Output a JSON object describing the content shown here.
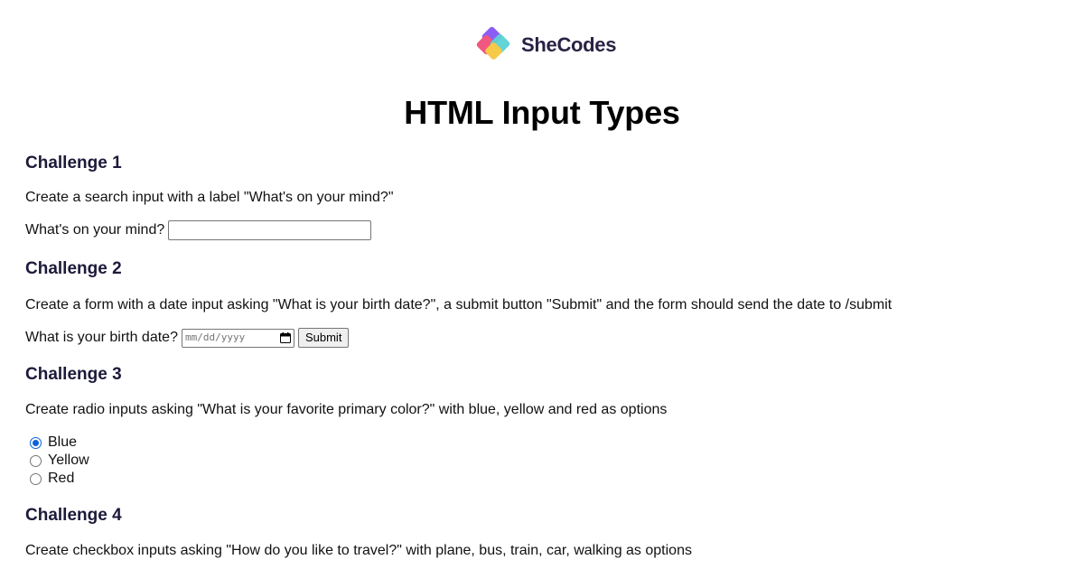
{
  "brand": {
    "name": "SheCodes"
  },
  "page": {
    "title": "HTML Input Types"
  },
  "challenges": [
    {
      "heading": "Challenge 1",
      "description": "Create a search input with a label \"What's on your mind?\"",
      "label": "What's on your mind?",
      "input_value": ""
    },
    {
      "heading": "Challenge 2",
      "description": "Create a form with a date input asking \"What is your birth date?\", a submit button \"Submit\" and the form should send the date to /submit",
      "label": "What is your birth date?",
      "date_placeholder": "mm/dd/yyyy",
      "submit_label": "Submit"
    },
    {
      "heading": "Challenge 3",
      "description": "Create radio inputs asking \"What is your favorite primary color?\" with blue, yellow and red as options",
      "options": [
        {
          "label": "Blue",
          "checked": true
        },
        {
          "label": "Yellow",
          "checked": false
        },
        {
          "label": "Red",
          "checked": false
        }
      ]
    },
    {
      "heading": "Challenge 4",
      "description": "Create checkbox inputs asking \"How do you like to travel?\" with plane, bus, train, car, walking as options"
    }
  ],
  "colors": {
    "heading": "#1c1a3a",
    "radio_checked": "#0b62d6",
    "logo_pink": "#f0587f",
    "logo_purple": "#8b5cf6",
    "logo_teal": "#5cd2d4",
    "logo_yellow": "#f7c948"
  }
}
